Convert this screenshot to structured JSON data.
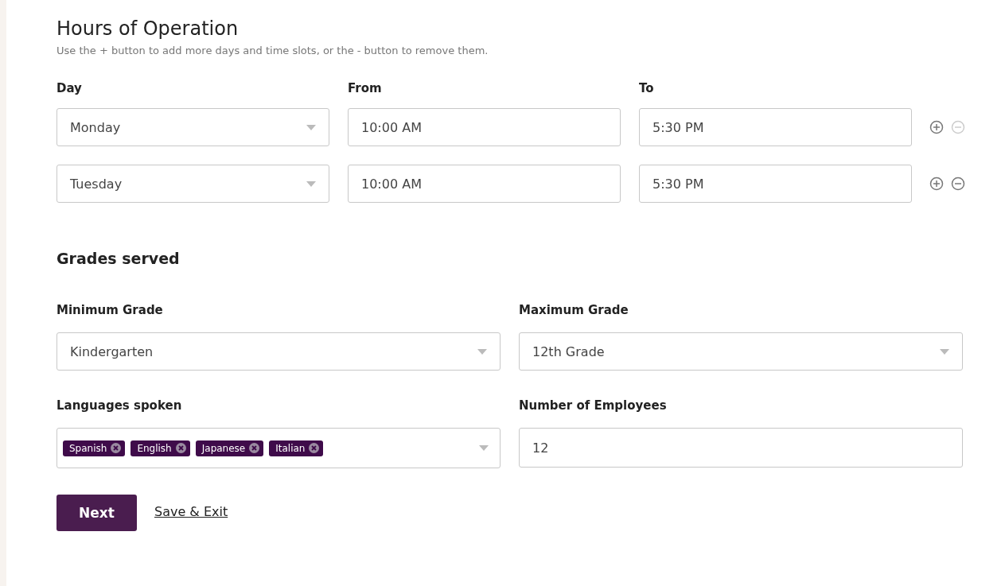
{
  "hours": {
    "title": "Hours of Operation",
    "hint": "Use the + button to add more days and time slots, or the - button to remove them.",
    "columns": [
      "Day",
      "From",
      "To"
    ],
    "rows": [
      {
        "day": "Monday",
        "from": "10:00 AM",
        "to": "5:30 PM",
        "remove_disabled": true
      },
      {
        "day": "Tuesday",
        "from": "10:00 AM",
        "to": "5:30 PM",
        "remove_disabled": false
      }
    ]
  },
  "grades": {
    "title": "Grades served",
    "min_label": "Minimum Grade",
    "min_value": "Kindergarten",
    "max_label": "Maximum Grade",
    "max_value": "12th Grade"
  },
  "languages": {
    "label": "Languages spoken",
    "tags": [
      "Spanish",
      "English",
      "Japanese",
      "Italian"
    ]
  },
  "employees": {
    "label": "Number of Employees",
    "value": "12"
  },
  "actions": {
    "next": "Next",
    "save": "Save & Exit"
  }
}
